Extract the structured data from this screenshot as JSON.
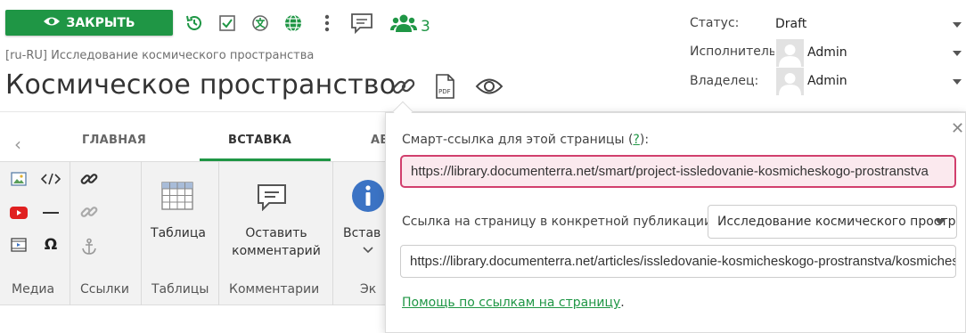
{
  "toolbar": {
    "close_label": "ЗАКРЫТЬ",
    "users_count": "3",
    "icons": [
      "eye-icon",
      "history-icon",
      "checkbox-icon",
      "translate-icon",
      "globe-icon",
      "more-vert-icon",
      "comment-icon",
      "users-icon"
    ]
  },
  "header": {
    "breadcrumb": "[ru-RU] Исследование космического пространства",
    "title": "Космическое пространство"
  },
  "meta": {
    "status_label": "Статус:",
    "status_value": "Draft",
    "assignee_label": "Исполнитель",
    "assignee_value": "Admin",
    "owner_label": "Владелец:",
    "owner_value": "Admin"
  },
  "ribbon": {
    "tabs": [
      {
        "label": "ГЛАВНАЯ"
      },
      {
        "label": "ВСТАВКА"
      },
      {
        "label": "АВ"
      }
    ],
    "groups": {
      "media": "Медиа",
      "links": "Ссылки",
      "tables": "Таблицы",
      "comments": "Комментарии",
      "last": "Эк"
    },
    "table_button": "Таблица",
    "comment_button_line1": "Оставить",
    "comment_button_line2": "комментарий",
    "insert_button": "Встав"
  },
  "popover": {
    "smart_label": "Смарт-ссылка для этой страницы (",
    "smart_help": "?",
    "smart_label_end": "):",
    "smart_url": "https://library.documenterra.net/smart/project-issledovanie-kosmicheskogo-prostranstva",
    "publication_label": "Ссылка на страницу в конкретной публикации:",
    "publication_value": "Исследование космического пространства",
    "article_url": "https://library.documenterra.net/articles/issledovanie-kosmicheskogo-prostranstva/kosmicheskoe-prostranstvo",
    "help_link": "Помощь по ссылкам на страницу",
    "help_link_end": "."
  },
  "colors": {
    "accent": "#1f9645",
    "smart_border": "#d13f6d",
    "smart_bg": "#fbe9ee"
  }
}
